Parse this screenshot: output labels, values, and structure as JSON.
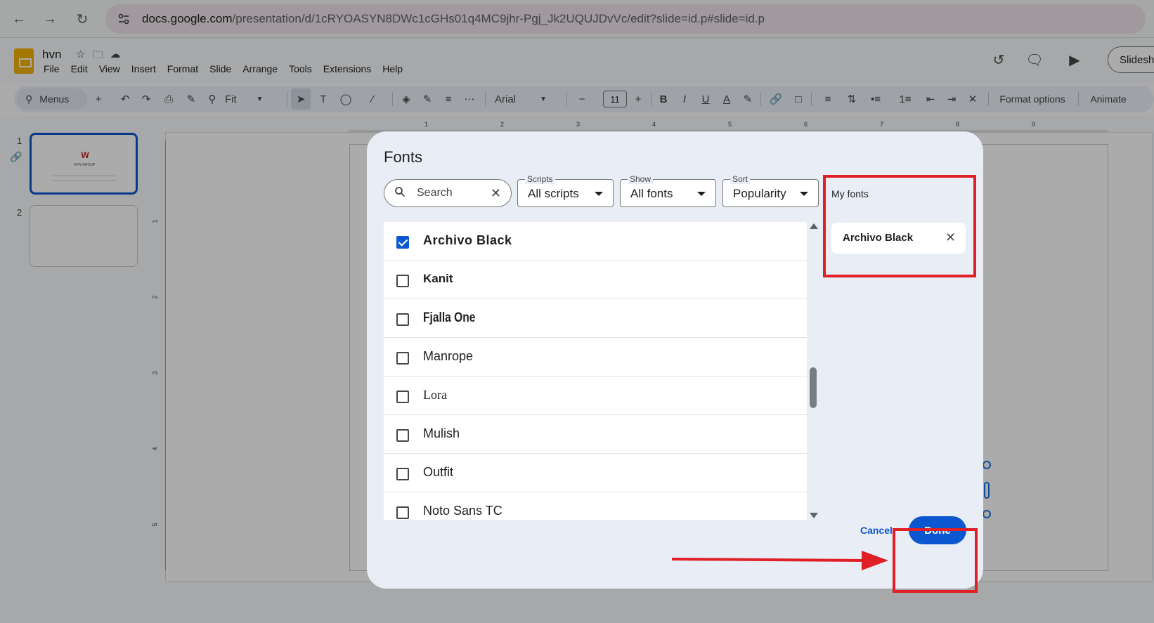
{
  "browser": {
    "url_domain": "docs.google.com",
    "url_path": "/presentation/d/1cRYOASYN8DWc1cGHs01q4MC9jhr-Pgj_Jk2UQUJDvVc/edit?slide=id.p#slide=id.p"
  },
  "app": {
    "doc_title": "hvn",
    "menu": [
      "File",
      "Edit",
      "View",
      "Insert",
      "Format",
      "Slide",
      "Arrange",
      "Tools",
      "Extensions",
      "Help"
    ],
    "slideshow_label": "Slidesh"
  },
  "toolbar": {
    "menus_label": "Menus",
    "zoom_label": "Fit",
    "font_label": "Arial",
    "font_size": "11",
    "format_options_label": "Format options",
    "animate_label": "Animate"
  },
  "filmstrip": {
    "slide_numbers": [
      "1",
      "2"
    ],
    "thumb_logo": "W",
    "thumb_caption": "HVN GROUP"
  },
  "ruler": {
    "top_numbers": [
      "1",
      "2",
      "3",
      "4",
      "5",
      "6",
      "7",
      "8",
      "9"
    ],
    "left_numbers": [
      "1",
      "2",
      "3",
      "4",
      "5"
    ]
  },
  "dialog": {
    "title": "Fonts",
    "search_placeholder": "Search",
    "scripts": {
      "label": "Scripts",
      "value": "All scripts"
    },
    "show": {
      "label": "Show",
      "value": "All fonts"
    },
    "sort": {
      "label": "Sort",
      "value": "Popularity"
    },
    "fonts": [
      {
        "name": "Archivo Black",
        "checked": true
      },
      {
        "name": "Kanit",
        "checked": false
      },
      {
        "name": "Fjalla One",
        "checked": false
      },
      {
        "name": "Manrope",
        "checked": false
      },
      {
        "name": "Lora",
        "checked": false
      },
      {
        "name": "Mulish",
        "checked": false
      },
      {
        "name": "Outfit",
        "checked": false
      },
      {
        "name": "Noto Sans TC",
        "checked": false
      }
    ],
    "my_fonts_title": "My fonts",
    "my_fonts": [
      "Archivo Black"
    ],
    "cancel_label": "Cancel",
    "done_label": "Done"
  },
  "colors": {
    "accent": "#0b57d0",
    "annotation": "#e01f26",
    "dialog_bg": "#e9eef6"
  }
}
